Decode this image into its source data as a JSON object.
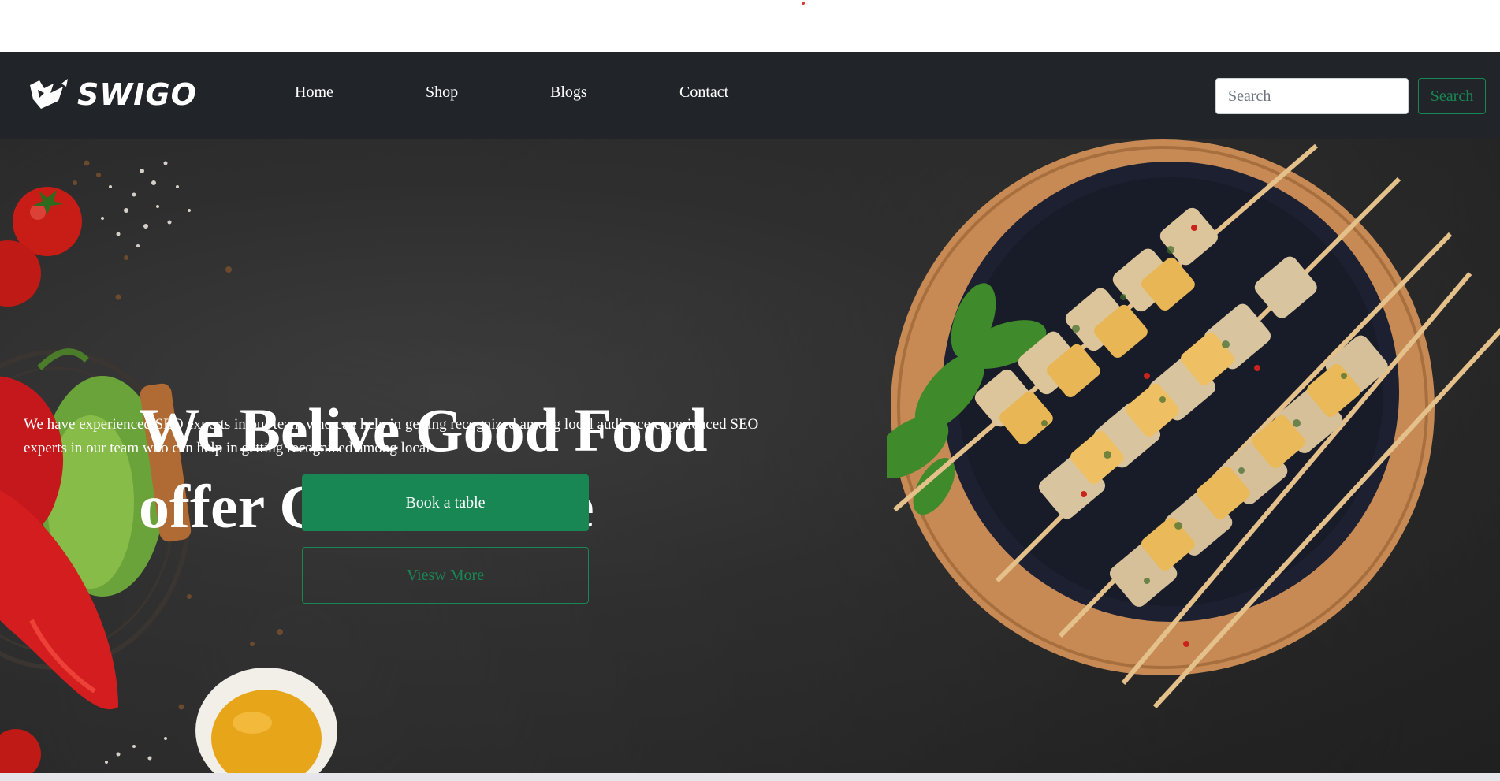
{
  "brand": {
    "name": "SWIGO",
    "logo_icon": "swigo-logo-icon"
  },
  "nav": {
    "links": [
      {
        "label": "Home"
      },
      {
        "label": "Shop"
      },
      {
        "label": "Blogs"
      },
      {
        "label": "Contact"
      }
    ]
  },
  "search": {
    "placeholder": "Search",
    "button_label": "Search"
  },
  "hero": {
    "title_line1": "We Belive Good Food",
    "title_line2": "offer Great Smile",
    "description": "We have experienced SEO experts in our team who can help in getting recognized among local audience experienced SEO experts in our team who can help in getting recognized among local",
    "primary_button": "Book a table",
    "secondary_button": "Viesw More"
  },
  "colors": {
    "navbar": "#212529",
    "accent_green": "#198754",
    "hero_background": "#2c2c2c"
  }
}
